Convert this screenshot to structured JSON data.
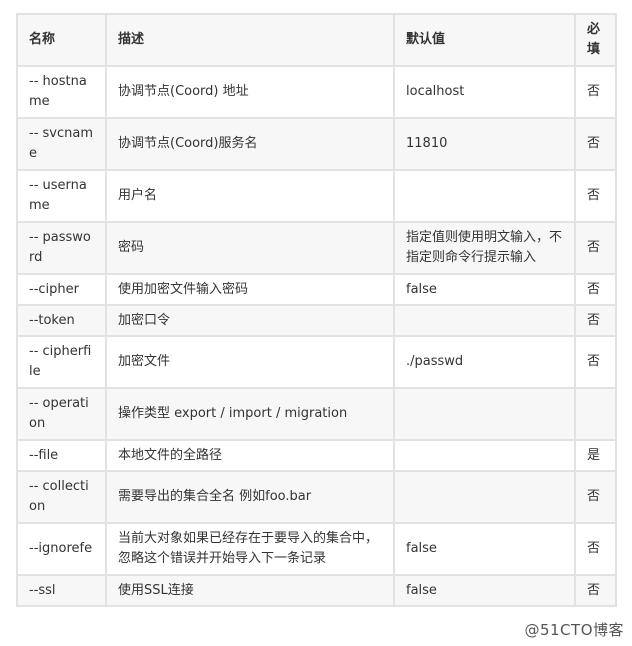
{
  "table": {
    "headers": {
      "name": "名称",
      "description": "描述",
      "default": "默认值",
      "required": "必\n填"
    },
    "rows": [
      {
        "name": "-- hostname",
        "description": "协调节点(Coord) 地址",
        "default": "localhost",
        "required": "否"
      },
      {
        "name": "-- svcname",
        "description": "协调节点(Coord)服务名",
        "default": "11810",
        "required": "否"
      },
      {
        "name": "-- username",
        "description": "用户名",
        "default": "",
        "required": "否"
      },
      {
        "name": "-- password",
        "description": "密码",
        "default": "指定值则使用明文输入，不指定则命令行提示输入",
        "required": "否"
      },
      {
        "name": "--cipher",
        "description": "使用加密文件输入密码",
        "default": "false",
        "required": "否"
      },
      {
        "name": "--token",
        "description": "加密口令",
        "default": "",
        "required": "否"
      },
      {
        "name": "-- cipherfile",
        "description": "加密文件",
        "default": "./passwd",
        "required": "否"
      },
      {
        "name": "-- operation",
        "description": "操作类型 export / import / migration",
        "default": "",
        "required": ""
      },
      {
        "name": "--file",
        "description": "本地文件的全路径",
        "default": "",
        "required": "是"
      },
      {
        "name": "-- collection",
        "description": "需要导出的集合全名 例如foo.bar",
        "default": "",
        "required": "否"
      },
      {
        "name": "--ignorefe",
        "description": "当前大对象如果已经存在于要导入的集合中，忽略这个错误并开始导入下一条记录",
        "default": "false",
        "required": "否"
      },
      {
        "name": "--ssl",
        "description": "使用SSL连接",
        "default": "false",
        "required": "否"
      }
    ]
  },
  "watermark": "@51CTO博客"
}
